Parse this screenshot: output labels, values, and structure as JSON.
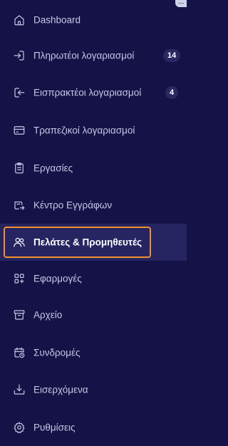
{
  "sidebar": {
    "accent_color": "#f2912d",
    "background_color": "#141246",
    "items": [
      {
        "label": "Dashboard",
        "icon": "home-icon"
      },
      {
        "label": "Πληρωτέοι λογαριασμοί",
        "icon": "bill-in-icon",
        "badge": "14"
      },
      {
        "label": "Εισπρακτέοι λογαριασμοί",
        "icon": "bill-out-icon",
        "badge": "4"
      },
      {
        "label": "Τραπεζικοί λογαριασμοί",
        "icon": "credit-card-icon"
      },
      {
        "label": "Εργασίες",
        "icon": "clipboard-icon"
      },
      {
        "label": "Κέντρο Εγγράφων",
        "icon": "documents-icon"
      },
      {
        "label": "Πελάτες & Προμηθευτές",
        "icon": "users-icon",
        "active": true
      },
      {
        "label": "Εφαρμογές",
        "icon": "apps-icon"
      },
      {
        "label": "Αρχείο",
        "icon": "archive-icon"
      },
      {
        "label": "Συνδρομές",
        "icon": "calendar-icon"
      },
      {
        "label": "Εισερχόμενα",
        "icon": "inbox-download-icon"
      },
      {
        "label": "Ρυθμίσεις",
        "icon": "settings-icon"
      }
    ]
  }
}
